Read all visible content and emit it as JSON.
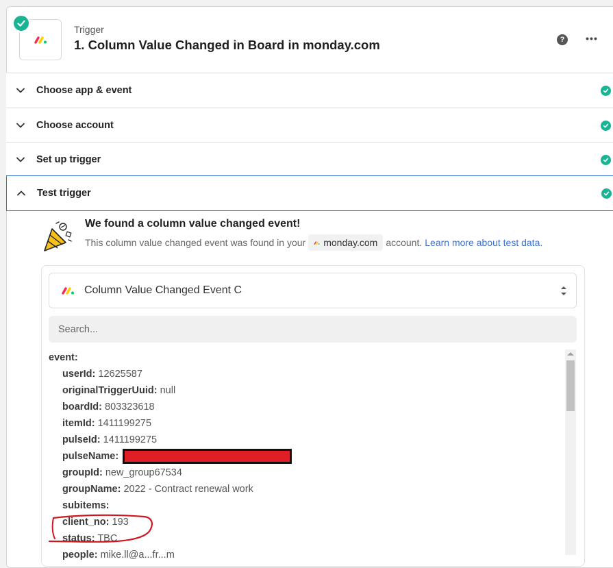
{
  "header": {
    "label": "Trigger",
    "title": "1. Column Value Changed in Board in monday.com",
    "help_icon": "?",
    "more_icon": "•••"
  },
  "steps": [
    {
      "label": "Choose app & event",
      "expanded": false,
      "complete": true
    },
    {
      "label": "Choose account",
      "expanded": false,
      "complete": true
    },
    {
      "label": "Set up trigger",
      "expanded": false,
      "complete": true
    },
    {
      "label": "Test trigger",
      "expanded": true,
      "complete": true
    }
  ],
  "test": {
    "found_title": "We found a column value changed event!",
    "found_desc_prefix": "This column value changed event was found in your",
    "app_chip": "monday.com",
    "found_desc_suffix": "account.",
    "learn_more": "Learn more about test data.",
    "record_select": "Column Value Changed Event C",
    "search_placeholder": "Search..."
  },
  "event_data": {
    "root_key": "event:",
    "fields": [
      {
        "key": "userId:",
        "value": "12625587"
      },
      {
        "key": "originalTriggerUuid:",
        "value": "null"
      },
      {
        "key": "boardId:",
        "value": "803323618"
      },
      {
        "key": "itemId:",
        "value": "1411199275"
      },
      {
        "key": "pulseId:",
        "value": "1411199275"
      },
      {
        "key": "pulseName:",
        "value": ""
      },
      {
        "key": "groupId:",
        "value": "new_group67534"
      },
      {
        "key": "groupName:",
        "value": "2022 - Contract renewal work"
      },
      {
        "key": "subitems:",
        "value": ""
      },
      {
        "key": "client_no:",
        "value": "193"
      },
      {
        "key": "status:",
        "value": "TBC"
      },
      {
        "key": "people:",
        "value": "mike.ll@a...fr...m"
      }
    ]
  },
  "colors": {
    "success": "#1ab394",
    "link": "#3b73d1",
    "active_border": "#3b73d1",
    "redaction": "#e01e26",
    "annotation": "#d0161e"
  }
}
